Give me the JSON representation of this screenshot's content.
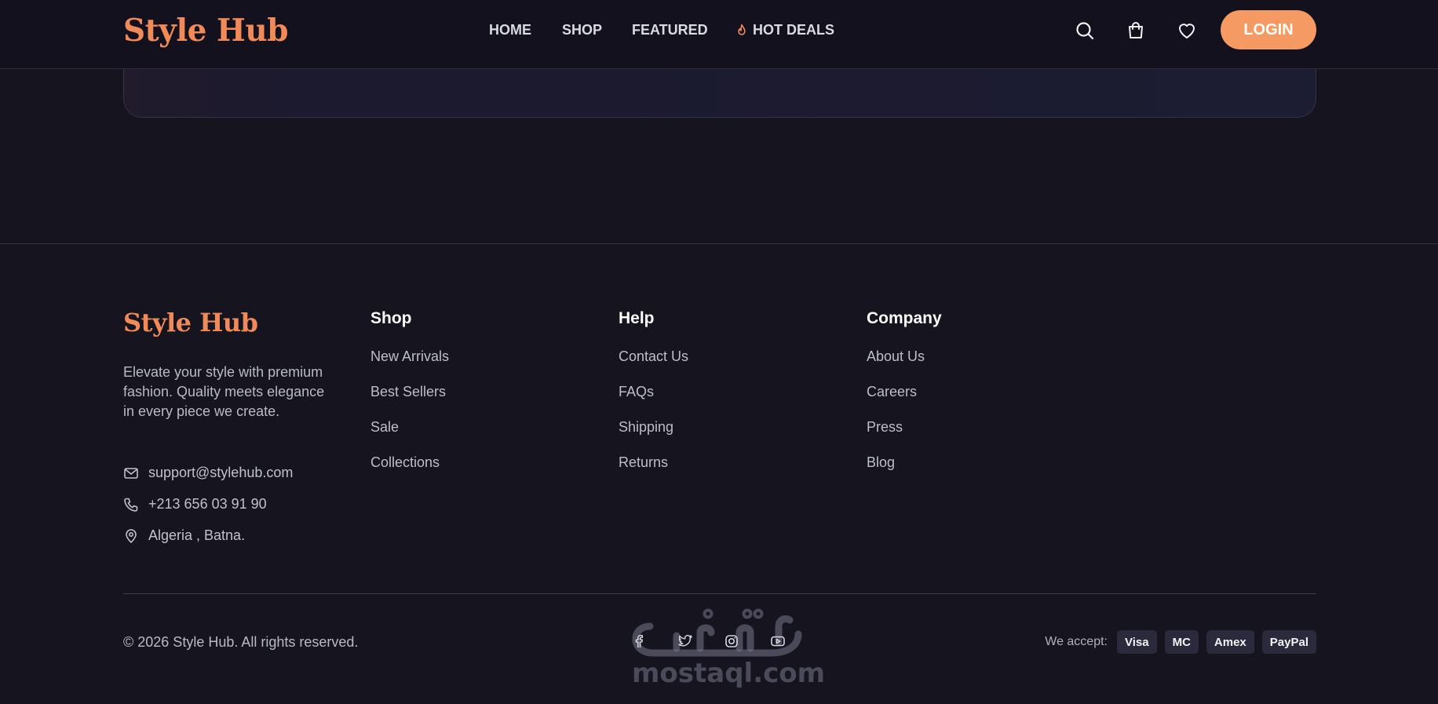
{
  "header": {
    "brand": "Style Hub",
    "nav": [
      "HOME",
      "SHOP",
      "FEATURED",
      "HOT DEALS"
    ],
    "login_label": "LOGIN",
    "icons": [
      "search-icon",
      "cart-icon",
      "heart-icon",
      "flame-icon"
    ]
  },
  "footer": {
    "brand": "Style Hub",
    "description": "Elevate your style with premium fashion. Quality meets elegance in every piece we create.",
    "contact": {
      "email": "support@stylehub.com",
      "phone": "+213 656 03 91 90",
      "location": "Algeria , Batna."
    },
    "columns": [
      {
        "title": "Shop",
        "links": [
          "New Arrivals",
          "Best Sellers",
          "Sale",
          "Collections"
        ]
      },
      {
        "title": "Help",
        "links": [
          "Contact Us",
          "FAQs",
          "Shipping",
          "Returns"
        ]
      },
      {
        "title": "Company",
        "links": [
          "About Us",
          "Careers",
          "Press",
          "Blog"
        ]
      }
    ],
    "copyright": "© 2026 Style Hub. All rights reserved.",
    "social": [
      "facebook-icon",
      "twitter-icon",
      "instagram-icon",
      "youtube-icon"
    ],
    "accept_label": "We accept:",
    "payment_methods": [
      "Visa",
      "MC",
      "Amex",
      "PayPal"
    ]
  },
  "watermark": {
    "arabic": "مستقل",
    "latin": "mostaql.com"
  },
  "colors": {
    "background": "#15141f",
    "header_bg": "#12111d",
    "brand_accent": "#f08a58",
    "login_button": "#f49a62",
    "payment_badge_bg": "#2a2a3c"
  }
}
